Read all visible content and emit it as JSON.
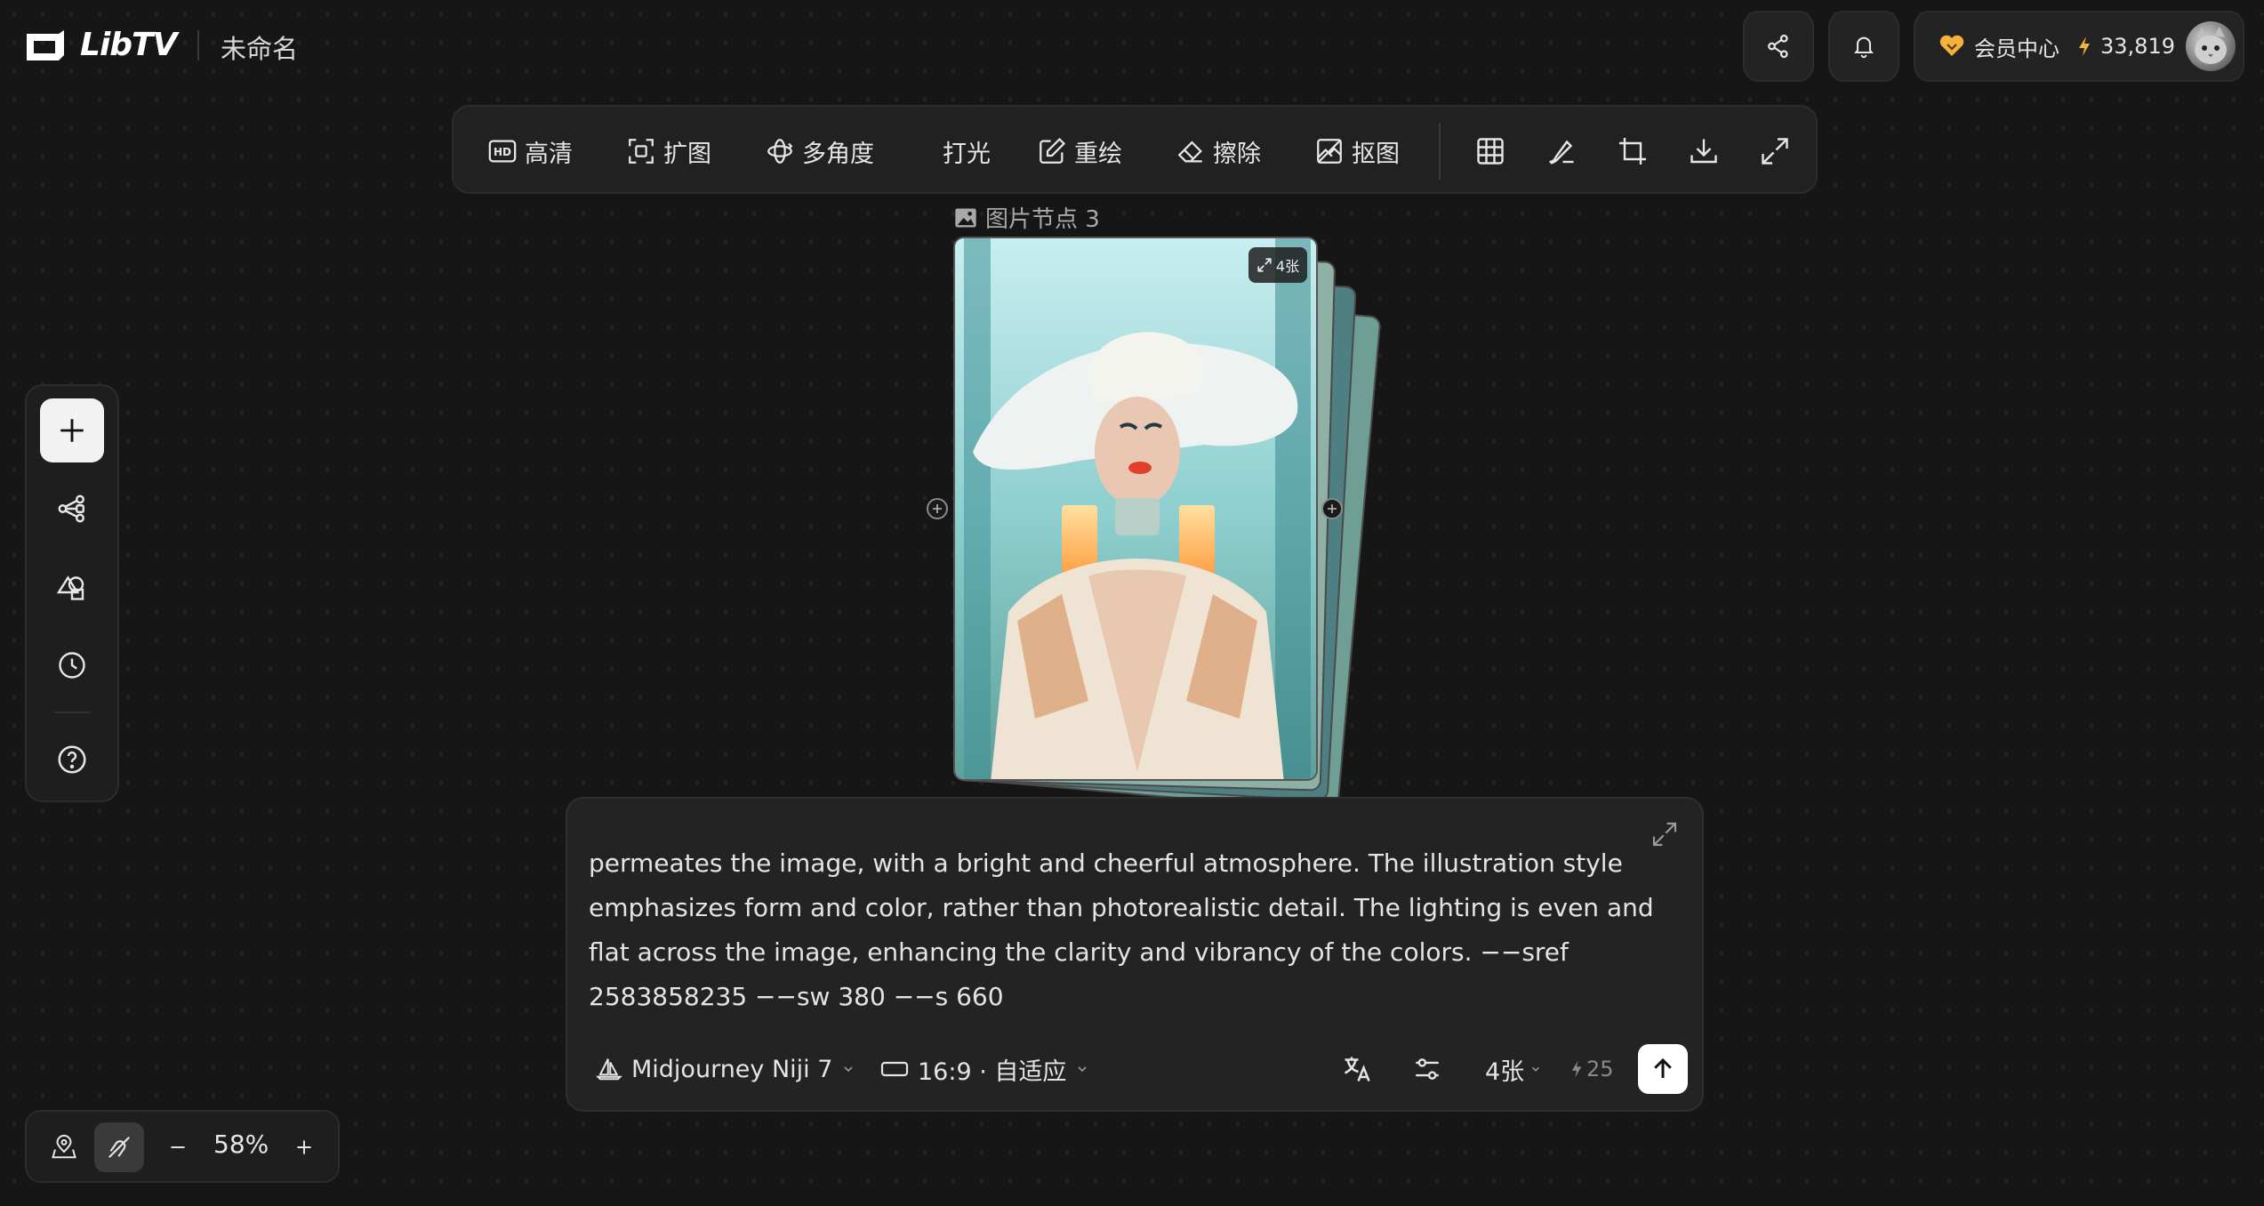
{
  "app": {
    "name": "LibTV",
    "doc_title": "未命名"
  },
  "header": {
    "member_label": "会员中心",
    "credits": "33,819",
    "icons": [
      "share-icon",
      "bell-icon"
    ]
  },
  "toolbar": {
    "tools": [
      {
        "label": "高清",
        "icon": "hd-icon"
      },
      {
        "label": "扩图",
        "icon": "expand-icon"
      },
      {
        "label": "多角度",
        "icon": "rotate-icon"
      },
      {
        "label": "打光",
        "icon": "light-icon"
      },
      {
        "label": "重绘",
        "icon": "edit-icon"
      },
      {
        "label": "擦除",
        "icon": "eraser-icon"
      },
      {
        "label": "抠图",
        "icon": "cutout-icon"
      }
    ],
    "icon_tools": [
      "grid-icon",
      "brush-icon",
      "crop-icon",
      "download-icon",
      "fullscreen-icon"
    ]
  },
  "node": {
    "label": "图片节点 3",
    "count_badge": "4张"
  },
  "prompt": {
    "text": "permeates the image, with a bright and cheerful atmosphere. The illustration style emphasizes form and color, rather than photorealistic detail. The lighting is even and flat across the image, enhancing the clarity and vibrancy of the colors. −−sref 2583858235 −−sw 380 −−s 660",
    "model": "Midjourney Niji 7",
    "aspect": "16:9 · 自适应",
    "count": "4张",
    "cost": "25"
  },
  "zoom": {
    "value": "58%"
  },
  "colors": {
    "background": "#161616",
    "panel": "#232323",
    "accent_gold": "#f3b23c"
  }
}
